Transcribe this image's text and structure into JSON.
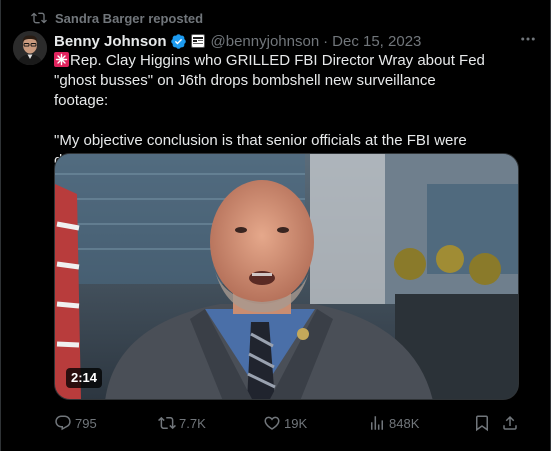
{
  "repost": {
    "text": "Sandra Barger reposted",
    "icon": "repost-icon"
  },
  "author": {
    "name": "Benny Johnson",
    "handle": "@bennyjohnson",
    "separator": "·",
    "date": "Dec 15, 2023",
    "verified_icon": "verified-badge-icon",
    "verified_color": "#1d9bf0",
    "affiliate_icon": "affiliate-badge-icon"
  },
  "tweet": {
    "emoji_icon": "siren-emoji-icon",
    "line1": "Rep. Clay Higgins who GRILLED FBI Director Wray about Fed \"ghost busses\" on J6th drops bombshell new surveillance footage:",
    "line2": "\"My objective conclusion is that senior officials at the FBI were deeply involved there.\""
  },
  "media": {
    "type": "video",
    "duration": "2:14"
  },
  "actions": {
    "replies": "795",
    "reposts": "7.7K",
    "likes": "19K",
    "views": "848K"
  },
  "colors": {
    "background": "#000000",
    "text_primary": "#e7e9ea",
    "text_secondary": "#71767b",
    "border": "#2f3336"
  }
}
